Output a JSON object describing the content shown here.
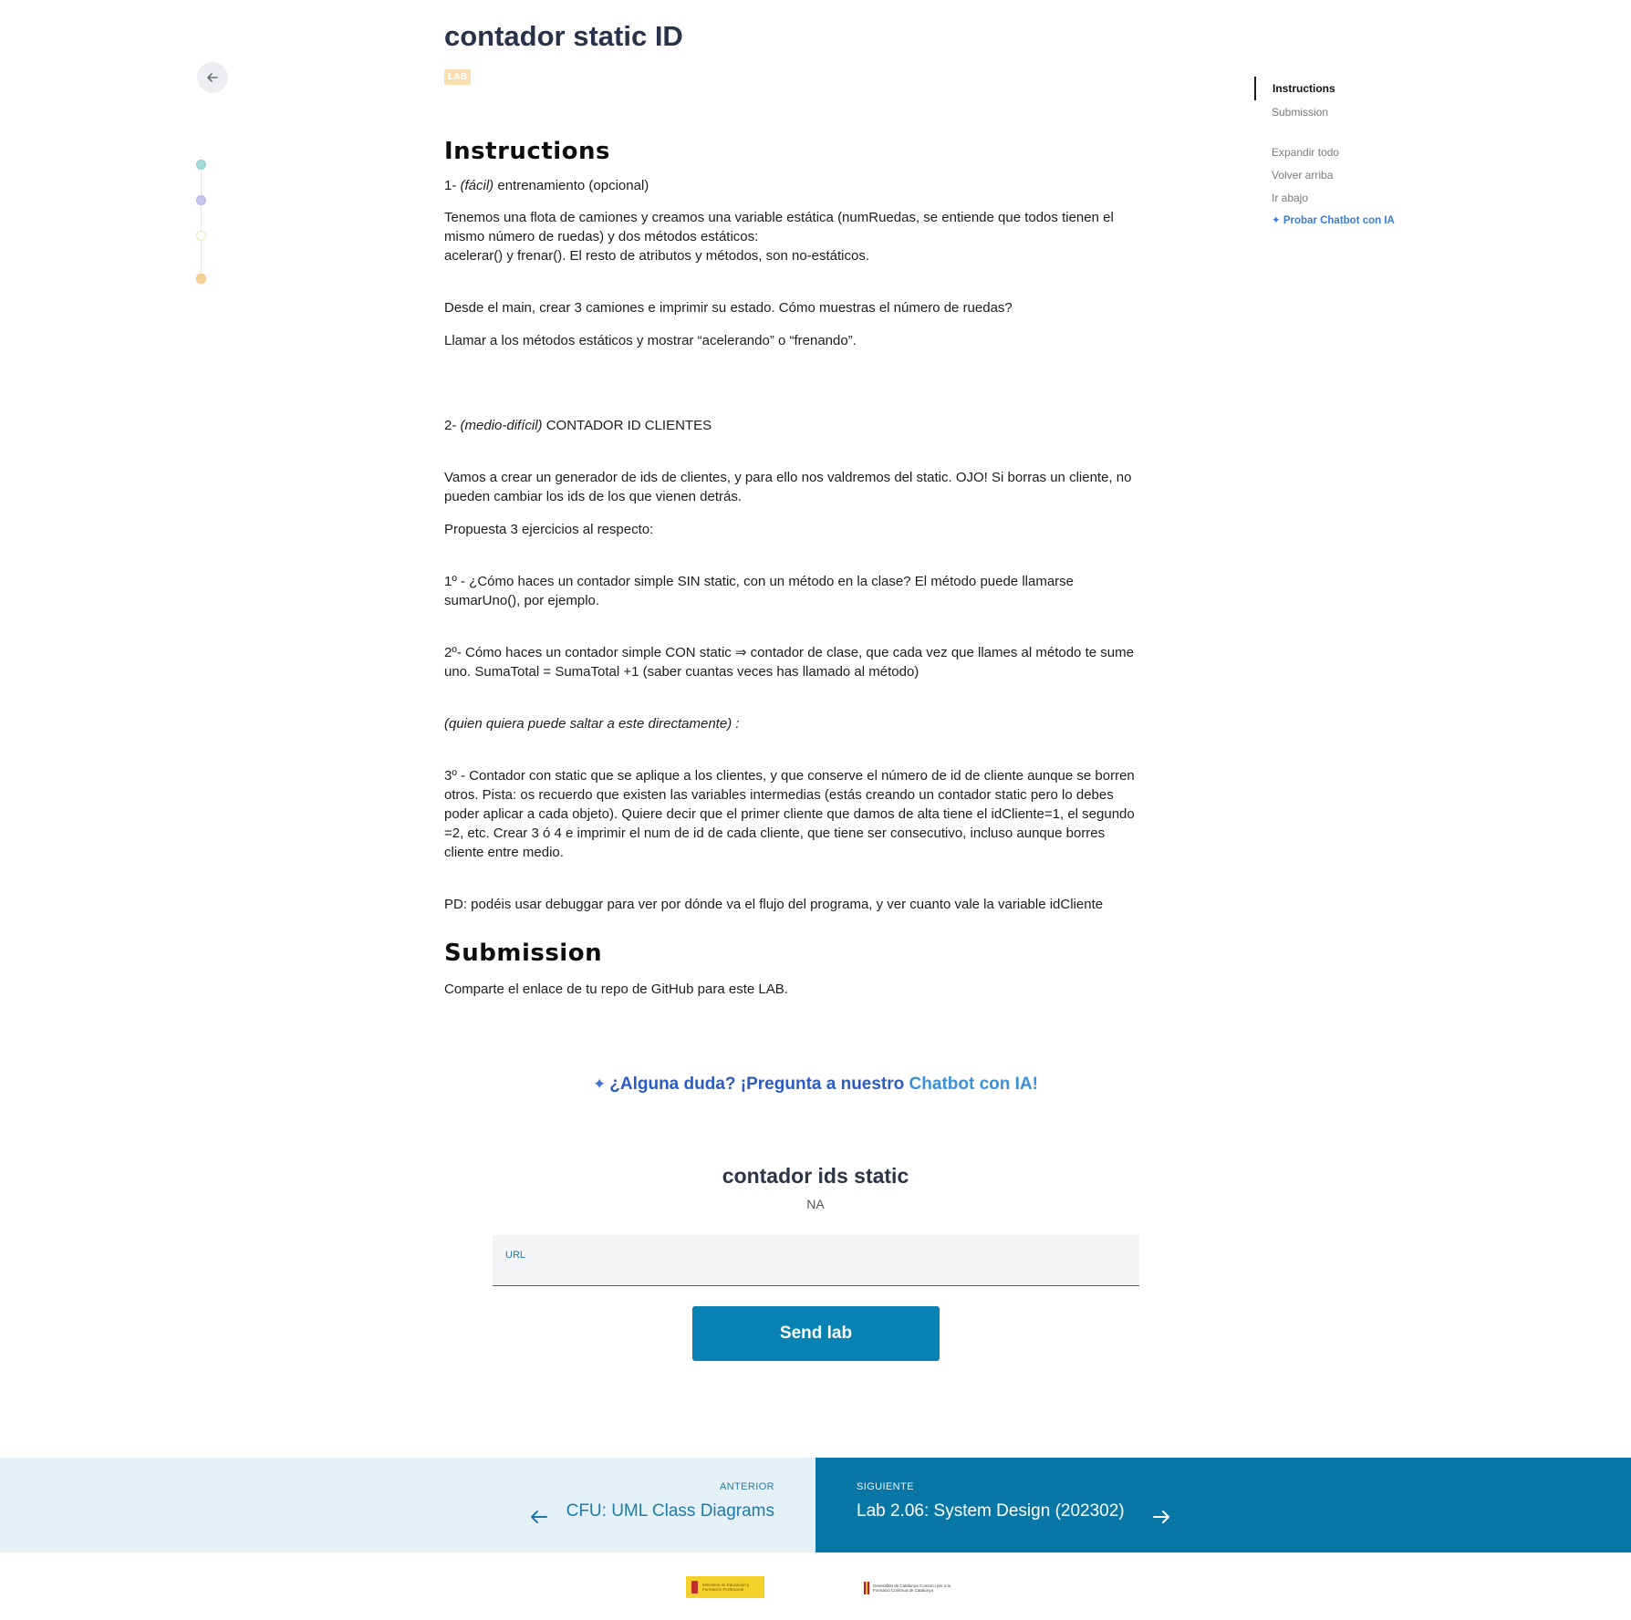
{
  "header": {
    "title": "contador static ID",
    "badge": "LAB"
  },
  "instructions": {
    "heading": "Instructions",
    "p1_num": "1- ",
    "p1_em": "(fácil)",
    "p1_rest": " entrenamiento (opcional)",
    "p2_l1": "Tenemos una flota de camiones y creamos una variable estática (numRuedas, se entiende que todos tienen el",
    "p2_l2": "mismo número de ruedas) y dos métodos estáticos:",
    "p2_l3": "acelerar() y frenar(). El resto de atributos y métodos, son no-estáticos.",
    "p3": "Desde el main, crear 3 camiones e imprimir su estado. Cómo muestras el número de ruedas?",
    "p4": "Llamar a los métodos estáticos y mostrar “acelerando” o “frenando”.",
    "p5_num": "2- ",
    "p5_em": "(medio-difícil)",
    "p5_rest": " CONTADOR ID CLIENTES",
    "p6_l1": "Vamos a crear un generador de ids de clientes, y para ello nos valdremos del static. OJO! Si borras un cliente, no",
    "p6_l2": "pueden cambiar los ids de los que vienen detrás.",
    "p7": "Propuesta 3 ejercicios al respecto:",
    "p8_l1": "1º - ¿Cómo haces un contador simple SIN static, con un método en la clase? El método puede llamarse",
    "p8_l2": "sumarUno(), por ejemplo.",
    "p9_l1": "2º- Cómo haces un contador simple CON static ⇒ contador de clase, que cada vez que llames al método te sume",
    "p9_l2": "uno. SumaTotal = SumaTotal +1 (saber cuantas veces has llamado al método)",
    "p10": "(quien quiera puede saltar a este directamente) :",
    "p11_l1": "3º - Contador con static que se aplique a los clientes, y que conserve el número de id de cliente aunque se borren",
    "p11_l2": "otros. Pista: os recuerdo que existen las variables intermedias (estás creando un contador static pero lo debes",
    "p11_l3": "poder aplicar a cada objeto). Quiere decir que el primer cliente que damos de alta tiene el idCliente=1, el segundo",
    "p11_l4": "=2, etc. Crear 3 ó 4 e imprimir el num de id de cada cliente, que tiene ser consecutivo, incluso aunque borres",
    "p11_l5": "cliente entre medio.",
    "p12": "PD: podéis usar debuggar para ver por dónde va el flujo del programa, y ver cuanto vale la variable idCliente"
  },
  "submission": {
    "heading": "Submission",
    "text": "Comparte el enlace de tu repo de GitHub para este LAB."
  },
  "cta": {
    "sparkle": "✦",
    "part1": "¿Alguna duda? ¡Pregunta a nuestro ",
    "part2": "Chatbot con IA!"
  },
  "form": {
    "title": "contador ids static",
    "status": "NA",
    "url_label": "URL",
    "url_value": "",
    "send_label": "Send lab"
  },
  "toc": {
    "items": [
      "Instructions",
      "Submission"
    ],
    "tools": [
      "Expandir todo",
      "Volver arriba",
      "Ir abajo"
    ],
    "ai_link": "✦ Probar Chatbot con IA"
  },
  "nav": {
    "prev_kicker": "ANTERIOR",
    "prev_title": "CFU: UML Class Diagrams",
    "next_kicker": "SIGUIENTE",
    "next_title": "Lab 2.06: System Design (202302)"
  },
  "footer": {
    "logo_es_text": "Ministerio de Educación y Formación Profesional",
    "logo_cat_text": "Generalitat de Catalunya Consorci per a la Formació Contínua de Catalunya"
  },
  "colors": {
    "accent": "#0782b3",
    "nav_prev_bg": "#e6f1f7",
    "nav_next_bg": "#0877a6",
    "badge": "#f9dfb0"
  }
}
